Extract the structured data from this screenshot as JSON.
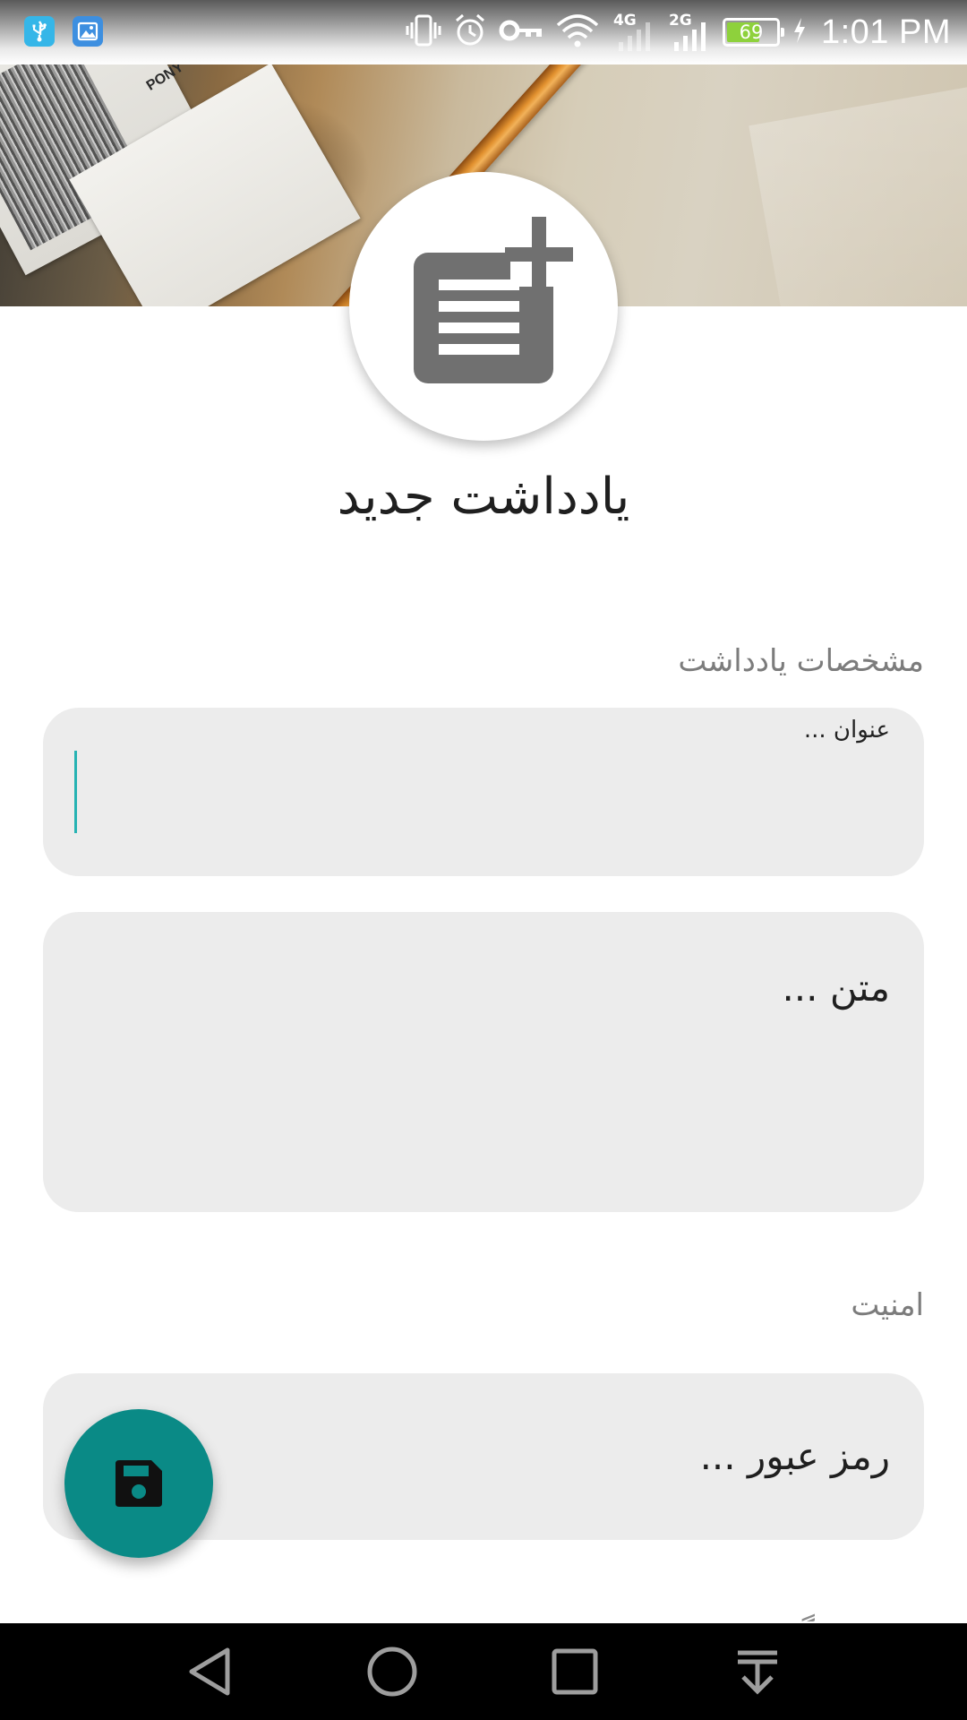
{
  "status_bar": {
    "left_icons": [
      "usb-icon",
      "gallery-icon"
    ],
    "right_icons": [
      "vibrate-icon",
      "alarm-icon",
      "vpn-key-icon",
      "wifi-icon",
      "signal-4g-icon",
      "signal-2g-icon",
      "battery-charging-icon"
    ],
    "network_4g": "4G",
    "network_2g": "2G",
    "battery_percent": "69",
    "battery_level": 0.69,
    "time": "1:01 PM"
  },
  "header": {
    "image_text": "PONY",
    "icon": "note-add-icon"
  },
  "page": {
    "title": "یادداشت جدید"
  },
  "details_section": {
    "label": "مشخصات یادداشت",
    "title_field": {
      "label": "عنوان ...",
      "value": ""
    },
    "body_field": {
      "placeholder": "متن ..."
    }
  },
  "security_section": {
    "label": "امنیت",
    "password_field": {
      "placeholder": "رمز عبور ..."
    }
  },
  "next_section_peek": "گروه بندی",
  "fab": {
    "icon": "save-icon"
  },
  "nav_bar": {
    "icons": [
      "back-icon",
      "home-icon",
      "recents-icon",
      "notification-pull-icon"
    ]
  },
  "colors": {
    "accent": "#0a8a86",
    "caret": "#26b3b3",
    "field_background": "#ececec",
    "battery_fill": "#8ed13c"
  }
}
